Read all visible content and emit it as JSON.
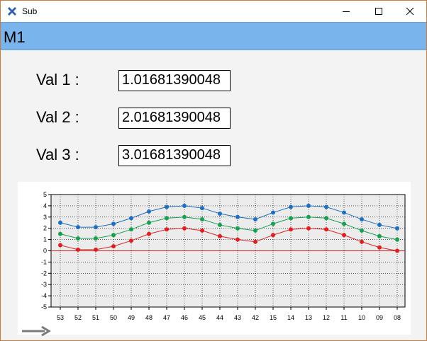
{
  "window": {
    "title": "Sub",
    "controls": {
      "minimize": "minimize",
      "maximize": "maximize",
      "close": "close"
    }
  },
  "banner": {
    "title": "M1"
  },
  "fields": [
    {
      "label": "Val 1 :",
      "value": "1.01681390048"
    },
    {
      "label": "Val 2 :",
      "value": "2.01681390048"
    },
    {
      "label": "Val 3 :",
      "value": "3.01681390048"
    }
  ],
  "colors": {
    "banner": "#7ab4ec",
    "series_blue": "#1f6fc0",
    "series_green": "#18a050",
    "series_red": "#e02020",
    "plot_bg": "#ececec"
  },
  "chart_data": {
    "type": "line",
    "categories": [
      "53",
      "52",
      "51",
      "50",
      "49",
      "48",
      "47",
      "46",
      "45",
      "44",
      "43",
      "42",
      "15",
      "14",
      "13",
      "12",
      "11",
      "10",
      "09",
      "08"
    ],
    "ylim": [
      -5,
      5
    ],
    "yticks": [
      "5",
      "4",
      "3",
      "2",
      "1",
      "0",
      "-1",
      "-2",
      "-3",
      "-4",
      "-5"
    ],
    "grid": true,
    "series": [
      {
        "color": "#1f6fc0",
        "values": [
          2.5,
          2.1,
          2.1,
          2.4,
          2.9,
          3.5,
          3.9,
          4.0,
          3.8,
          3.3,
          3.0,
          2.8,
          3.4,
          3.9,
          4.0,
          3.9,
          3.4,
          2.8,
          2.3,
          2.0
        ]
      },
      {
        "color": "#18a050",
        "values": [
          1.5,
          1.1,
          1.1,
          1.4,
          1.9,
          2.5,
          2.9,
          3.0,
          2.8,
          2.3,
          2.0,
          1.8,
          2.4,
          2.9,
          3.0,
          2.9,
          2.4,
          1.8,
          1.3,
          1.0
        ]
      },
      {
        "color": "#e02020",
        "values": [
          0.5,
          0.1,
          0.1,
          0.4,
          0.9,
          1.5,
          1.9,
          2.0,
          1.8,
          1.3,
          1.0,
          0.8,
          1.4,
          1.9,
          2.0,
          1.9,
          1.4,
          0.8,
          0.3,
          0.0
        ]
      }
    ]
  },
  "scroll_hint": {
    "icon": "right-arrow-icon"
  }
}
